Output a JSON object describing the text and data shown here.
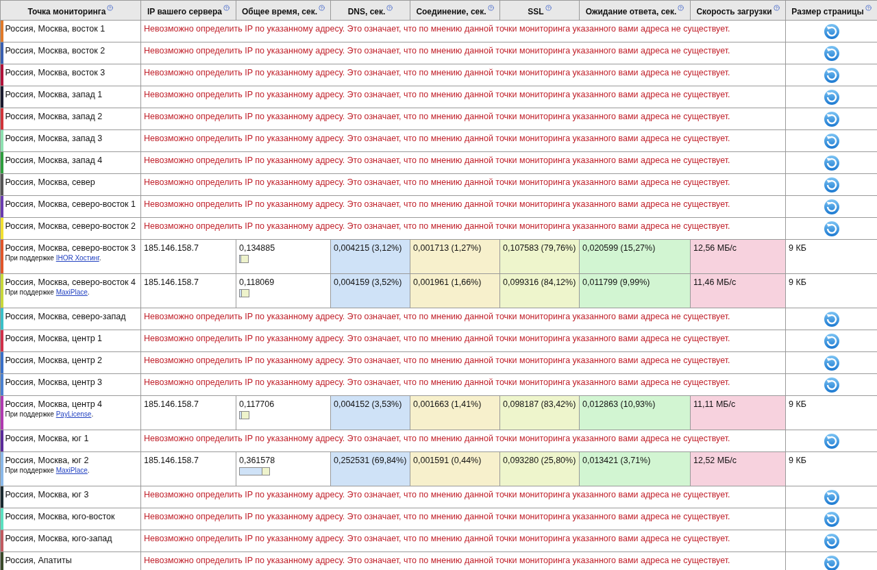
{
  "columns": [
    {
      "label": "Точка мониторинга",
      "help": true
    },
    {
      "label": "IP вашего сервера",
      "help": true
    },
    {
      "label": "Общее время, сек.",
      "help": true
    },
    {
      "label": "DNS, сек.",
      "help": true
    },
    {
      "label": "Соединение, сек.",
      "help": true
    },
    {
      "label": "SSL",
      "help": true
    },
    {
      "label": "Ожидание ответа, сек.",
      "help": true
    },
    {
      "label": "Скорость загрузки",
      "help": true
    },
    {
      "label": "Размер страницы",
      "help": true
    }
  ],
  "rows": [
    {
      "kind": "error",
      "location": "Россия, Москва, восток 1",
      "color": "#e07a2a",
      "message": "Невозможно определить IP по указанному адресу. Это означает, что по мнению данной точки мониторинга указанного вами адреса не существует."
    },
    {
      "kind": "error",
      "location": "Россия, Москва, восток 2",
      "color": "#3a5fb0",
      "message": "Невозможно определить IP по указанному адресу. Это означает, что по мнению данной точки мониторинга указанного вами адреса не существует."
    },
    {
      "kind": "error",
      "location": "Россия, Москва, восток 3",
      "color": "#b0123a",
      "message": "Невозможно определить IP по указанному адресу. Это означает, что по мнению данной точки мониторинга указанного вами адреса не существует."
    },
    {
      "kind": "error",
      "location": "Россия, Москва, запад 1",
      "color": "#1a1a2e",
      "message": "Невозможно определить IP по указанному адресу. Это означает, что по мнению данной точки мониторинга указанного вами адреса не существует."
    },
    {
      "kind": "error",
      "location": "Россия, Москва, запад 2",
      "color": "#d0343a",
      "message": "Невозможно определить IP по указанному адресу. Это означает, что по мнению данной точки мониторинга указанного вами адреса не существует."
    },
    {
      "kind": "error",
      "location": "Россия, Москва, запад 3",
      "color": "#8ee0b0",
      "message": "Невозможно определить IP по указанному адресу. Это означает, что по мнению данной точки мониторинга указанного вами адреса не существует."
    },
    {
      "kind": "error",
      "location": "Россия, Москва, запад 4",
      "color": "#2e9e3e",
      "message": "Невозможно определить IP по указанному адресу. Это означает, что по мнению данной точки мониторинга указанного вами адреса не существует."
    },
    {
      "kind": "error",
      "location": "Россия, Москва, север",
      "color": "#555555",
      "message": "Невозможно определить IP по указанному адресу. Это означает, что по мнению данной точки мониторинга указанного вами адреса не существует."
    },
    {
      "kind": "error",
      "location": "Россия, Москва, северо-восток 1",
      "color": "#6a3cb0",
      "message": "Невозможно определить IP по указанному адресу. Это означает, что по мнению данной точки мониторинга указанного вами адреса не существует."
    },
    {
      "kind": "error",
      "location": "Россия, Москва, северо-восток 2",
      "color": "#f2e030",
      "message": "Невозможно определить IP по указанному адресу. Это означает, что по мнению данной точки мониторинга указанного вами адреса не существует."
    },
    {
      "kind": "result",
      "location": "Россия, Москва, северо-восток 3",
      "color": "#e0562a",
      "sponsor": {
        "prefix": "При поддержке",
        "link": "IHOR Хостинг",
        "suffix": "."
      },
      "ip": "185.146.158.7",
      "total": "0,134885",
      "level": 0.03,
      "dns": "0,004215 (3,12%)",
      "connect": "0,001713 (1,27%)",
      "ssl": "0,107583 (79,76%)",
      "wait": "0,020599 (15,27%)",
      "speed": "12,56 МБ/с",
      "size": "9 КБ"
    },
    {
      "kind": "result",
      "location": "Россия, Москва, северо-восток 4",
      "color": "#c8d83a",
      "sponsor": {
        "prefix": "При поддержке",
        "link": "MaxiPlace",
        "suffix": "."
      },
      "ip": "185.146.158.7",
      "total": "0,118069",
      "level": 0.04,
      "dns": "0,004159 (3,52%)",
      "connect": "0,001961 (1,66%)",
      "ssl": "0,099316 (84,12%)",
      "wait": "0,011799 (9,99%)",
      "speed": "11,46 МБ/с",
      "size": "9 КБ"
    },
    {
      "kind": "error",
      "location": "Россия, Москва, северо-запад",
      "color": "#3ac0c8",
      "message": "Невозможно определить IP по указанному адресу. Это означает, что по мнению данной точки мониторинга указанного вами адреса не существует."
    },
    {
      "kind": "error",
      "location": "Россия, Москва, центр 1",
      "color": "#d0304a",
      "message": "Невозможно определить IP по указанному адресу. Это означает, что по мнению данной точки мониторинга указанного вами адреса не существует."
    },
    {
      "kind": "error",
      "location": "Россия, Москва, центр 2",
      "color": "#3a70c8",
      "message": "Невозможно определить IP по указанному адресу. Это означает, что по мнению данной точки мониторинга указанного вами адреса не существует."
    },
    {
      "kind": "error",
      "location": "Россия, Москва, центр 3",
      "color": "#4a80d0",
      "message": "Невозможно определить IP по указанному адресу. Это означает, что по мнению данной точки мониторинга указанного вами адреса не существует."
    },
    {
      "kind": "result",
      "location": "Россия, Москва, центр 4",
      "color": "#b03ab0",
      "sponsor": {
        "prefix": "При поддержке",
        "link": "PayLicense",
        "suffix": "."
      },
      "ip": "185.146.158.7",
      "total": "0,117706",
      "level": 0.04,
      "dns": "0,004152 (3,53%)",
      "connect": "0,001663 (1,41%)",
      "ssl": "0,098187 (83,42%)",
      "wait": "0,012863 (10,93%)",
      "speed": "11,11 МБ/с",
      "size": "9 КБ"
    },
    {
      "kind": "error",
      "location": "Россия, Москва, юг 1",
      "color": "#5a2a9a",
      "message": "Невозможно определить IP по указанному адресу. Это означает, что по мнению данной точки мониторинга указанного вами адреса не существует."
    },
    {
      "kind": "result",
      "location": "Россия, Москва, юг 2",
      "color": "#8ab8e8",
      "sponsor": {
        "prefix": "При поддержке",
        "link": "MaxiPlace",
        "suffix": "."
      },
      "ip": "185.146.158.7",
      "total": "0,361578",
      "level": 0.7,
      "dns": "0,252531 (69,84%)",
      "connect": "0,001591 (0,44%)",
      "ssl": "0,093280 (25,80%)",
      "wait": "0,013421 (3,71%)",
      "speed": "12,52 МБ/с",
      "size": "9 КБ"
    },
    {
      "kind": "error",
      "location": "Россия, Москва, юг 3",
      "color": "#1a2a30",
      "message": "Невозможно определить IP по указанному адресу. Это означает, что по мнению данной точки мониторинга указанного вами адреса не существует."
    },
    {
      "kind": "error",
      "location": "Россия, Москва, юго-восток",
      "color": "#5ae0c0",
      "message": "Невозможно определить IP по указанному адресу. Это означает, что по мнению данной точки мониторинга указанного вами адреса не существует."
    },
    {
      "kind": "error",
      "location": "Россия, Москва, юго-запад",
      "color": "#c05a60",
      "message": "Невозможно определить IP по указанному адресу. Это означает, что по мнению данной точки мониторинга указанного вами адреса не существует."
    },
    {
      "kind": "error",
      "location": "Россия, Апатиты",
      "color": "#3a4a2a",
      "message": "Невозможно определить IP по указанному адресу. Это означает, что по мнению данной точки мониторинга указанного вами адреса не существует."
    }
  ]
}
